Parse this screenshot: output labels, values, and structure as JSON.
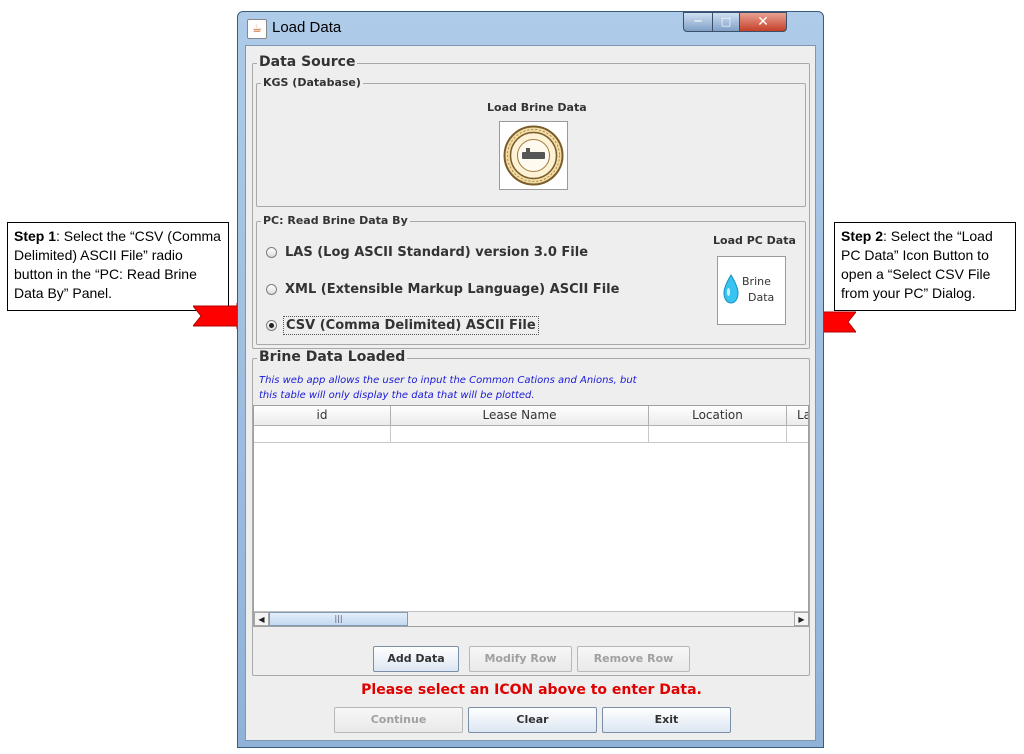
{
  "callouts": {
    "step1": {
      "prefix": "Step 1",
      "text": ": Select the “CSV (Comma Delimited) ASCII File” radio button in the “PC: Read Brine Data By” Panel."
    },
    "step2": {
      "prefix": "Step 2",
      "text": ": Select the “Load PC Data” Icon Button to open a “Select CSV File from your PC” Dialog."
    }
  },
  "window": {
    "title": "Load Data",
    "app_icon_glyph": "☕"
  },
  "data_source": {
    "title": "Data Source",
    "kgs": {
      "title": "KGS (Database)",
      "load_label": "Load Brine Data",
      "icon": "kgs-seal-icon"
    },
    "pc": {
      "title": "PC: Read Brine Data By",
      "options": [
        {
          "label": "LAS (Log ASCII Standard) version 3.0 File",
          "checked": false
        },
        {
          "label": "XML (Extensible Markup Language) ASCII File",
          "checked": false
        },
        {
          "label": "CSV (Comma Delimited) ASCII File",
          "checked": true
        }
      ],
      "load_label": "Load PC Data",
      "icon_text": [
        "Brine",
        "Data"
      ],
      "icon": "water-drop-icon"
    }
  },
  "brine": {
    "title": "Brine Data Loaded",
    "note_line1": "This web app allows the user to input the Common Cations and Anions, but",
    "note_line2": "this table will only display the data that will be plotted.",
    "columns": [
      "id",
      "Lease Name",
      "Location",
      "La"
    ],
    "buttons": {
      "add": "Add Data",
      "modify": "Modify Row",
      "remove": "Remove Row"
    }
  },
  "status_message": "Please select an ICON above to enter Data.",
  "footer": {
    "continue": "Continue",
    "clear": "Clear",
    "exit": "Exit"
  },
  "colors": {
    "status": "#e00000",
    "note": "#1a1ad6",
    "arrow": "#ff0000"
  }
}
